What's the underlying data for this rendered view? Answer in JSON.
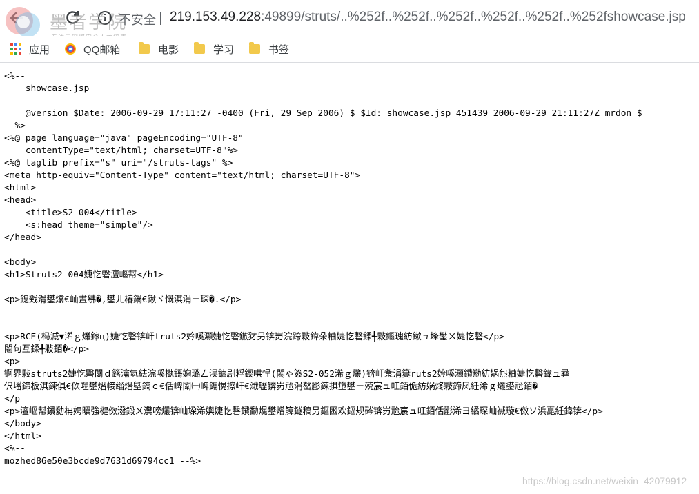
{
  "browser": {
    "security_label": "不安全",
    "url_host": "219.153.49.228",
    "url_rest": ":49899/struts/..%252f..%252f..%252f..%252f..%252f..%252fshowcase.jsp"
  },
  "logo": {
    "text": "墨者学院",
    "subtitle": "专注于网络安全人才培养"
  },
  "bookmarks": [
    {
      "label": "应用",
      "icon": "apps-grid-icon"
    },
    {
      "label": "QQ邮箱",
      "icon": "qq-mail-icon"
    },
    {
      "label": "电影",
      "icon": "folder-icon"
    },
    {
      "label": "学习",
      "icon": "folder-icon"
    },
    {
      "label": "书签",
      "icon": "folder-icon"
    }
  ],
  "source_lines": [
    "<%--",
    "    showcase.jsp",
    "",
    "    @version $Date: 2006-09-29 17:11:27 -0400 (Fri, 29 Sep 2006) $ $Id: showcase.jsp 451439 2006-09-29 21:11:27Z mrdon $",
    "--%>",
    "<%@ page language=\"java\" pageEncoding=\"UTF-8\"",
    "    contentType=\"text/html; charset=UTF-8\"%>",
    "<%@ taglib prefix=\"s\" uri=\"/struts-tags\" %>",
    "<meta http-equiv=\"Content-Type\" content=\"text/html; charset=UTF-8\">",
    "<html>",
    "<head>",
    "    <title>S2-004</title>",
    "    <s:head theme=\"simple\"/>",
    "</head>",
    "",
    "<body>",
    "<h1>Struts2-004婕忔礊澶嶇幇</h1>",
    "",
    "<p>鎴戣滑鐢熻€屾晝绋�,鐢ㄦ椿鍋€鍬ヾ慨淇涓ㄧ琛�.</p>",
    "",
    "",
    "<p>RCE(杩滅▼浠ｇ爜鎵ц)婕忔礊锛屽truts2妗嗘灦婕忔礊鏃犲叧锛岃浣跨敤鍏朵粬婕忔礊鍒╃敤鏂瑰紡鏉ュ埄鐢ㄨ婕忔礊</p>",
    "闂句互鍒╃敤銆�</p>",
    "<p>",
    "锕界敤struts2婕忔礊闅ｄ簬瀹氫紶浣嗘槸鎶婅璐ㄥ洖鏀剧粰鍥哄悜(闂ゃ簽S2-052浠ｇ爜)锛屽洜涓簍ruts2妗嗘灦鐨勬紡娲炰粬婕忔礊鍏ュ彛",
    "伬墦鍗板淇鍊俱€佽嚜鐢熸帹缁熸墍鎬ｃ€佸崥闈㈠崥鑴愰擦屽€濈瓑锛岃兘涓嶅彲鍊掑墯鐢ㄧ殑宸ュ叿銆佹紡娲炵敤鍗凤紝浠ｇ爜鍙兘銆�",
    "</p",
    "<p>澶嶇幇鐨勬柟娉曞強楗傚潑鍛ㄨ瀵嗙爜锛屾垜浠嬩婕忔礊鐨勫熀鐢熷簲鐩稿叧鏂囦欢鏂规硶锛岃兘宸ュ叿銆佸彲浠ヨ繘琛屾祴璇€傚ソ浜嗭紝鍏锛</p>",
    "</body>",
    "</html>",
    "<%--",
    "mozhed86e50e3bcde9d7631d69794cc1 --%>"
  ],
  "watermark": "https://blog.csdn.net/weixin_42079912"
}
